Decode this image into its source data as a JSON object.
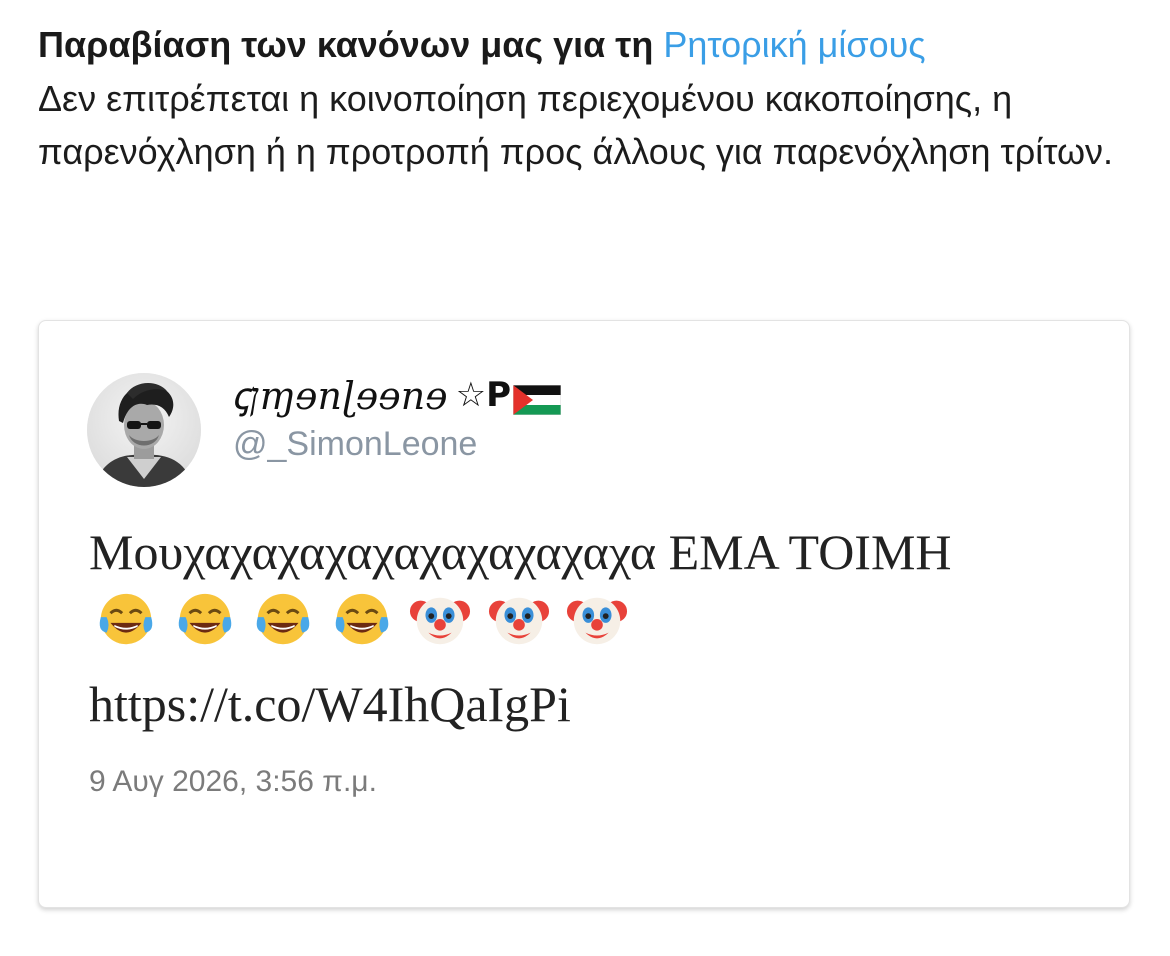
{
  "notice": {
    "title_prefix": "Παραβίαση των κανόνων μας για τη",
    "title_link": "Ρητορική μίσους",
    "body": "Δεν επιτρέπεται η κοινοποίηση περιεχομένου κακοποίησης, η παρενόχληση ή η προτροπή προς άλλους για παρενόχληση τρίτων.",
    "link_color": "#3a9ee6"
  },
  "tweet": {
    "display_name": "ꞔןɱɘnɭɘɘnɘ",
    "name_suffix_icon": "star-icon",
    "name_suffix_letter": "P",
    "name_flag_icon": "palestine-flag-icon",
    "handle": "@_SimonLeone",
    "text_line": "Μουχαχαχαχαχαχαχαχαχαχα ΕΜΑ ΤΟΙΜΗ",
    "emojis": [
      "face-with-tears-of-joy-icon",
      "face-with-tears-of-joy-icon",
      "face-with-tears-of-joy-icon",
      "face-with-tears-of-joy-icon",
      "clown-face-icon",
      "clown-face-icon",
      "clown-face-icon"
    ],
    "link": "https://t.co/W4IhQaIgPi",
    "timestamp": "9 Αυγ 2026, 3:56 π.μ."
  }
}
